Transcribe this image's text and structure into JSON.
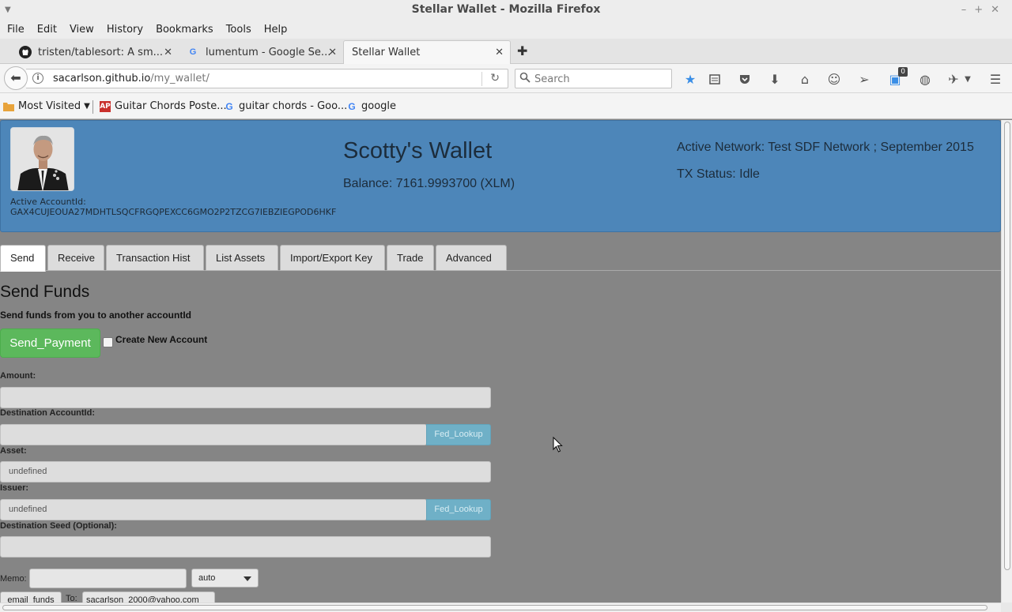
{
  "window": {
    "title": "Stellar Wallet - Mozilla Firefox"
  },
  "menu": [
    "File",
    "Edit",
    "View",
    "History",
    "Bookmarks",
    "Tools",
    "Help"
  ],
  "tabs": [
    {
      "label": "tristen/tablesort: A sm...",
      "icon": "github-icon"
    },
    {
      "label": "lumentum - Google Se...",
      "icon": "google-icon"
    },
    {
      "label": "Stellar Wallet",
      "icon": ""
    }
  ],
  "nav": {
    "url_host": "sacarlson.github.io",
    "url_path": "/my_wallet/",
    "search_placeholder": "Search",
    "notify_badge": "0"
  },
  "bookmarks": [
    {
      "label": "Most Visited",
      "icon": "folder-icon"
    },
    {
      "label": "Guitar Chords Poste...",
      "icon": "ap-icon"
    },
    {
      "label": "guitar chords - Goo...",
      "icon": "google-icon"
    },
    {
      "label": "google",
      "icon": "google-icon"
    }
  ],
  "wallet": {
    "title": "Scotty's Wallet",
    "balance": "Balance: 7161.9993700 (XLM)",
    "active_account_label": "Active AccountId:",
    "active_account_id": "GAX4CUJEOUA27MDHTLSQCFRGQPEXCC6GMO2P2TZCG7IEBZIEGPOD6HKF",
    "network": "Active Network: Test SDF Network ; September 2015",
    "tx_status": "TX Status: Idle"
  },
  "page_tabs": [
    "Send",
    "Receive",
    "Transaction Hist",
    "List Assets",
    "Import/Export Key",
    "Trade",
    "Advanced"
  ],
  "send_form": {
    "title": "Send Funds",
    "subtitle": "Send funds from you to another accountId",
    "send_button": "Send_Payment",
    "create_account_label": "Create New Account",
    "amount_label": "Amount:",
    "amount_value": "",
    "destination_label": "Destination AccountId:",
    "destination_value": "",
    "fed_lookup_label": "Fed_Lookup",
    "asset_label": "Asset:",
    "asset_value": "undefined",
    "issuer_label": "Issuer:",
    "issuer_value": "undefined",
    "seed_label": "Destination Seed (Optional):",
    "seed_value": "",
    "memo_label": "Memo:",
    "memo_value": "",
    "memo_type": "auto",
    "email_button": "email_funds",
    "to_label": "To:",
    "to_value": "sacarlson_2000@yahoo.com"
  },
  "colors": {
    "header_bg": "#4d86b9",
    "send_button": "#5cb85c",
    "fed_lookup": "#6fb0c7",
    "page_bg": "#858585"
  }
}
